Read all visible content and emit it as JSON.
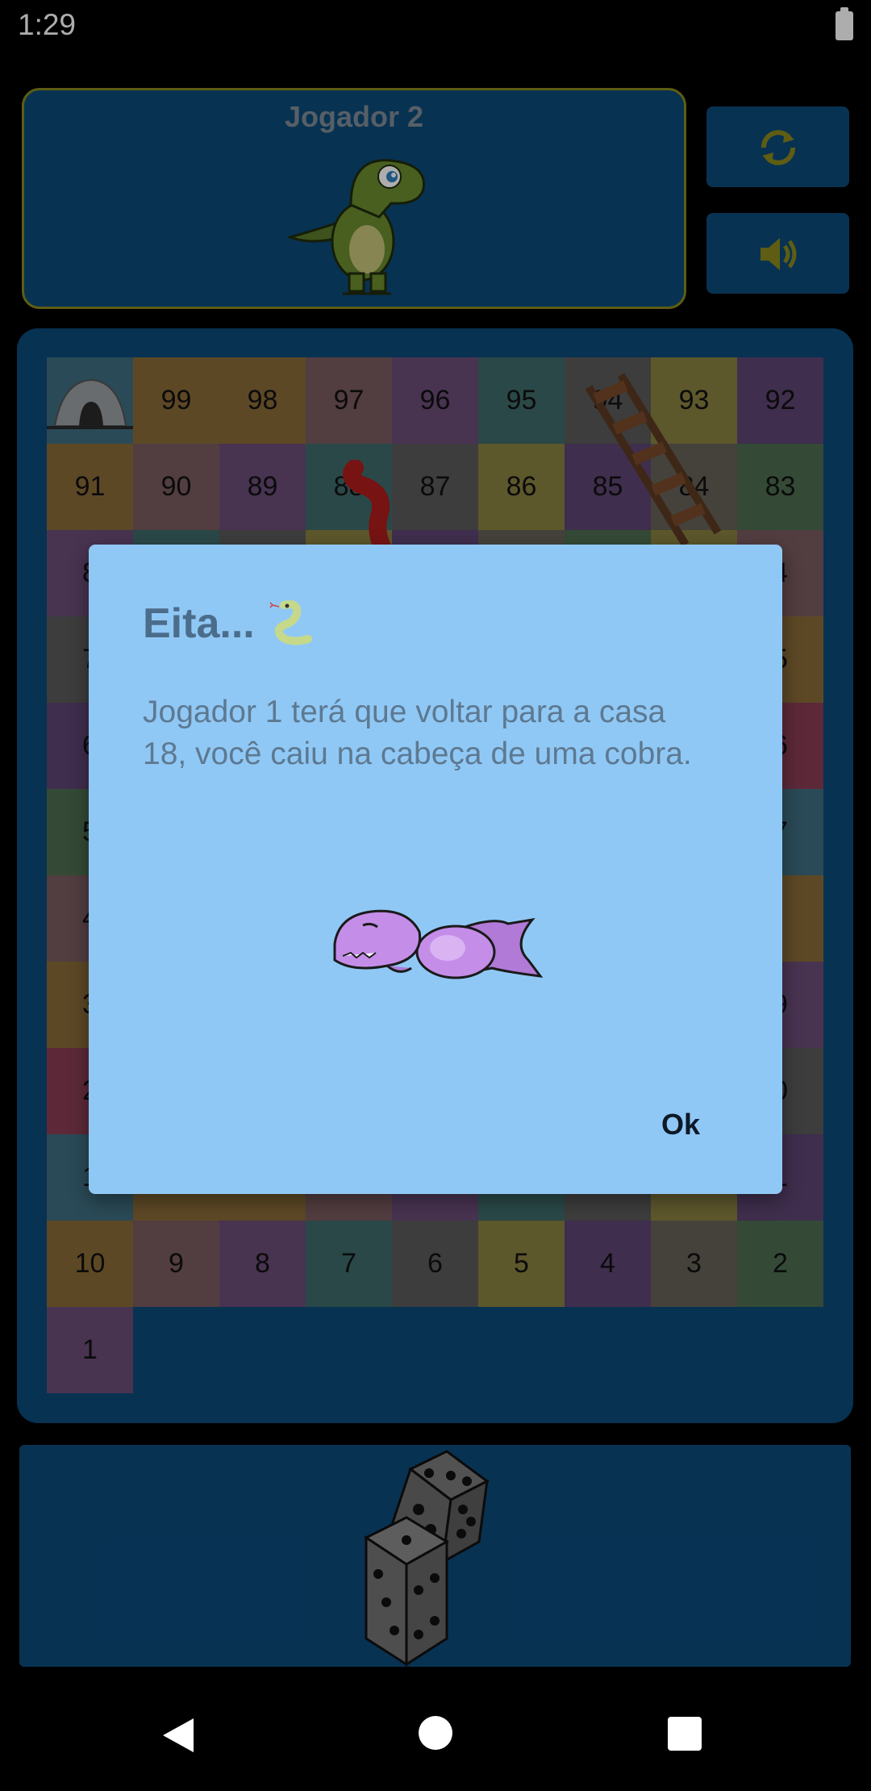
{
  "status_bar": {
    "time": "1:29"
  },
  "player_panel": {
    "name": "Jogador 2",
    "avatar_icon": "green-dinosaur"
  },
  "controls": [
    {
      "name": "restart",
      "icon": "refresh-icon"
    },
    {
      "name": "sound",
      "icon": "speaker-icon"
    }
  ],
  "board": {
    "rows": [
      [
        "",
        "99",
        "98",
        "97",
        "96",
        "95",
        "94",
        "93",
        "92"
      ],
      [
        "91",
        "90",
        "89",
        "88",
        "87",
        "86",
        "85",
        "84",
        "83"
      ],
      [
        "8",
        "",
        "",
        "",
        "",
        "",
        "",
        "",
        "4"
      ],
      [
        "7",
        "",
        "",
        "",
        "",
        "",
        "",
        "",
        "5"
      ],
      [
        "6",
        "",
        "",
        "",
        "",
        "",
        "",
        "",
        "6"
      ],
      [
        "5",
        "",
        "",
        "",
        "",
        "",
        "",
        "",
        "7"
      ],
      [
        "4",
        "",
        "",
        "",
        "",
        "",
        "",
        "",
        ""
      ],
      [
        "3",
        "",
        "",
        "",
        "",
        "",
        "",
        "",
        "9"
      ],
      [
        "2",
        "",
        "",
        "",
        "",
        "",
        "",
        "",
        "0"
      ],
      [
        "1",
        "",
        "",
        "",
        "",
        "",
        "",
        "",
        "1"
      ],
      [
        "10",
        "9",
        "8",
        "7",
        "6",
        "5",
        "4",
        "3",
        "2"
      ],
      [
        "1"
      ]
    ],
    "colors": [
      "#3f6d80",
      "#8a8042",
      "#6b4c78",
      "#5e5353",
      "#5d4572",
      "#8a6a38",
      "#7a5b5f",
      "#3f6a6a",
      "#8a3d55",
      "#666259",
      "#8a6a38",
      "#8a3d55",
      "#5a5a5a",
      "#4d6e50",
      "#4d6e50",
      "#7a5b5f",
      "#8a6a38",
      "#8a8042"
    ]
  },
  "dialog": {
    "title": "Eita...",
    "message": "Jogador 1 terá que voltar para a casa 18, você caiu na cabeça de uma cobra.",
    "ok_label": "Ok"
  },
  "dice": {
    "icon": "dice-icon"
  }
}
